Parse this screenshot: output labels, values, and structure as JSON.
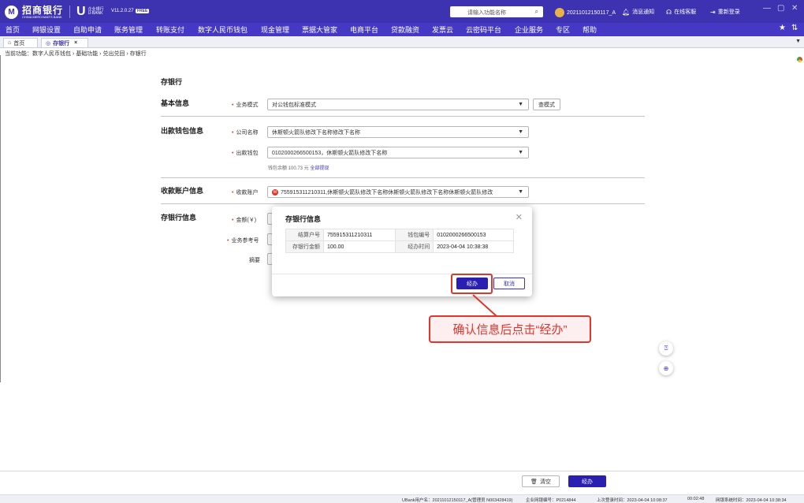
{
  "brand": {
    "bank_name_cn": "招商银行",
    "bank_name_en": "CHINA MERCHANTS BANK",
    "ubank_cn": "企业银行",
    "ubank_en": "U-BANK",
    "version": "V11.2.0.27",
    "version_badge": "FREE"
  },
  "topbar": {
    "search_placeholder": "请输入功能名称",
    "user": "20211012150117_A",
    "notifications": "消息通知",
    "online_service": "在线客服",
    "relogin": "重新登录",
    "window_controls": [
      "—",
      "▢",
      "✕"
    ]
  },
  "menu": {
    "items": [
      "首页",
      "网银设置",
      "自助申请",
      "账务管理",
      "转账支付",
      "数字人民币钱包",
      "现金管理",
      "票据大管家",
      "电商平台",
      "贷款融资",
      "发票云",
      "云密码平台",
      "企业服务",
      "专区",
      "帮助"
    ],
    "right_icons": [
      "star-icon",
      "pin-icon"
    ],
    "star": "★",
    "pin": "⇅"
  },
  "tabs": {
    "home": "首页",
    "active": "存银行",
    "close": "×"
  },
  "breadcrumb": "当前功能：数字人民币钱包 › 基础功能 › 兑出兑回 › 存银行",
  "form": {
    "title": "存银行",
    "sections": {
      "basic": "基本信息",
      "payer": "出款钱包信息",
      "payee": "收款账户信息",
      "deposit": "存银行信息"
    },
    "business_mode_label": "业务模式",
    "business_mode_value": "对公钱包标准模式",
    "view_mode_button": "查模式",
    "company_label": "公司名称",
    "company_value": "休斯顿火箭队修改下名称修改下名称",
    "wallet_label": "出款钱包",
    "wallet_value": "0102000266500153，休斯顿火箭队修改下名称",
    "wallet_balance_text": "钱包余额 100.73 元",
    "wallet_balance_link": "全部提现",
    "payee_label": "收款账户",
    "payee_value": "755915311210311,休斯顿火箭队修改下名称休斯顿火箭队修改下名称休斯顿火箭队修改",
    "amount_label": "金额(￥)",
    "ref_label": "业务参考号",
    "memo_label": "摘要"
  },
  "modal": {
    "title": "存银行信息",
    "rows": [
      {
        "k1": "结算户号",
        "v1": "755915311210311",
        "k2": "钱包编号",
        "v2": "0102000266500153"
      },
      {
        "k1": "存银行金额",
        "v1": "100.00",
        "k2": "经办时间",
        "v2": "2023-04-04 10:38:38"
      }
    ],
    "confirm_button": "经办",
    "cancel_button": "取消"
  },
  "callout": "确认信息后点击“经办”",
  "bottom_actions": {
    "clear_button": "清空",
    "submit_button": "经办"
  },
  "footer": {
    "ubank_user": "UBank用户名：20211012150117_A(管理员 N003428419)",
    "enterprise_no": "企业网银编号：P0214844",
    "last_login": "上次登录时间：2023-04-04 10:08:37",
    "elapsed": "00:02:48",
    "system_time": "网银系统时间：2023-04-04 10:38:34"
  },
  "colors": {
    "primary": "#3d32b0",
    "menu": "#4438c4",
    "accent_red": "#e0362e",
    "button_primary": "#2a1fb0"
  }
}
